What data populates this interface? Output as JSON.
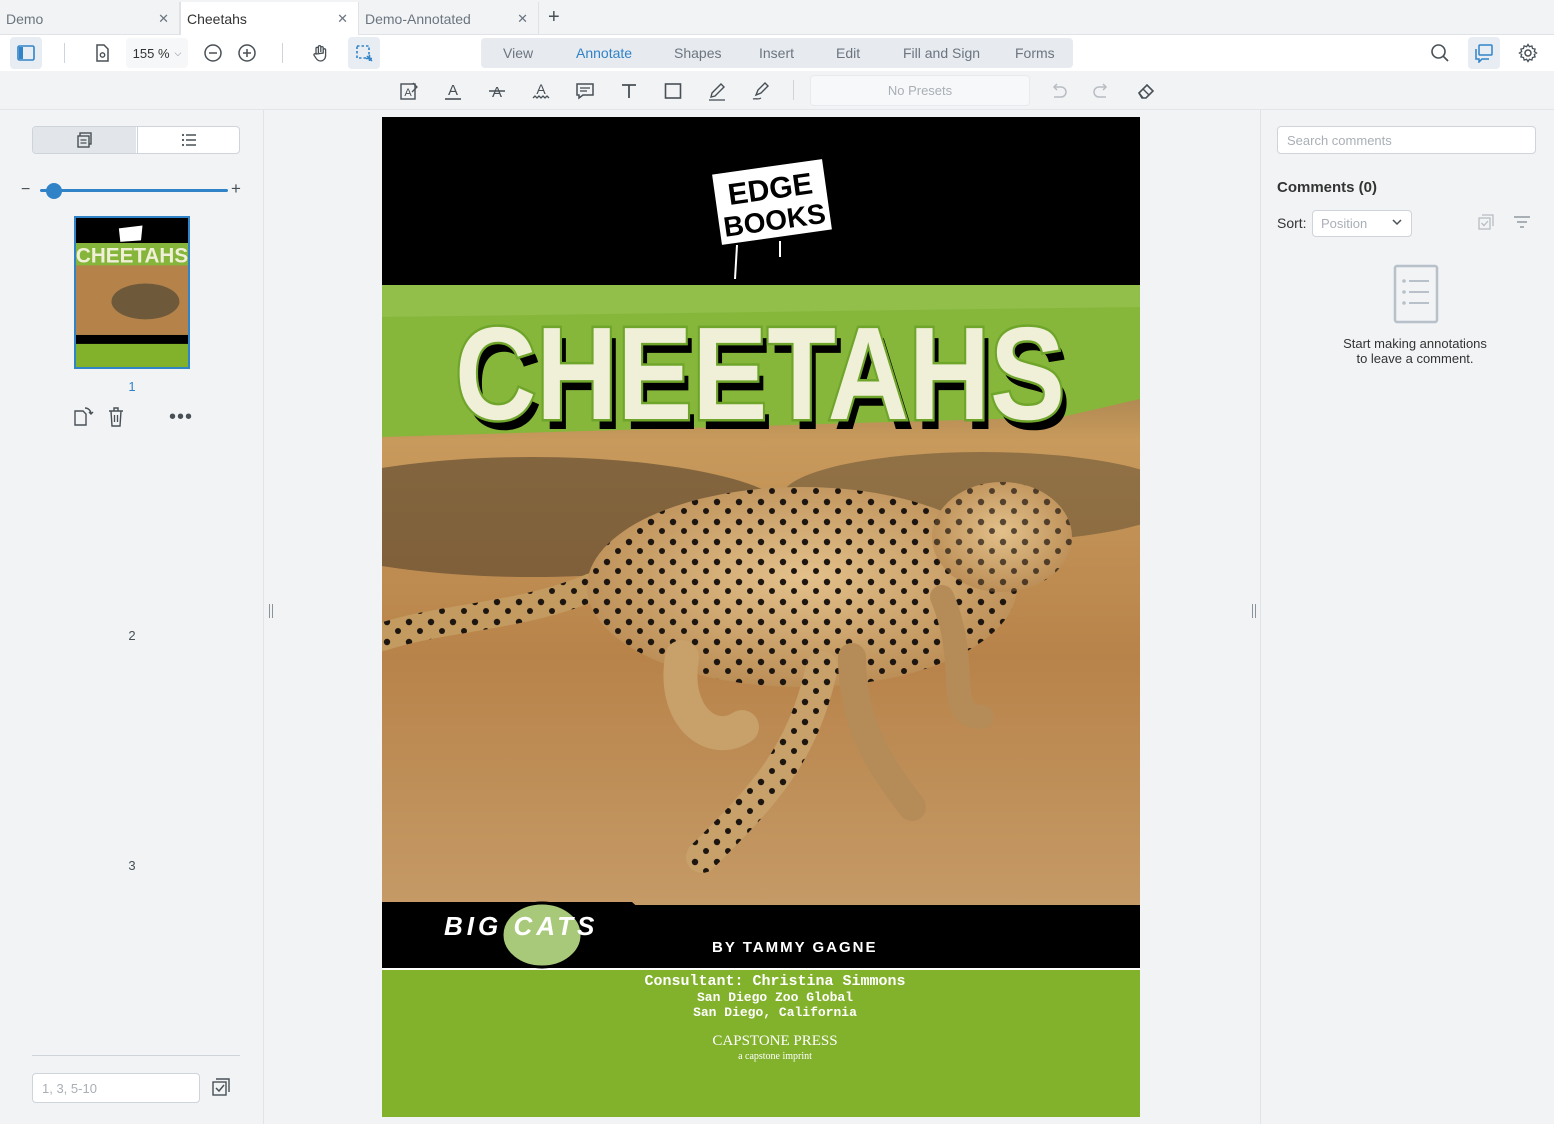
{
  "tabs": [
    {
      "label": "Demo",
      "active": false
    },
    {
      "label": "Cheetahs",
      "active": true
    },
    {
      "label": "Demo-Annotated",
      "active": false
    }
  ],
  "header": {
    "zoom": "155 %",
    "ribbons": [
      "View",
      "Annotate",
      "Shapes",
      "Insert",
      "Edit",
      "Fill and Sign",
      "Forms"
    ],
    "active_ribbon": "Annotate"
  },
  "toolbar": {
    "presets": "No Presets"
  },
  "left_panel": {
    "pages": [
      "1",
      "2",
      "3"
    ],
    "page_input_placeholder": "1, 3, 5-10"
  },
  "document": {
    "publisher_logo": "EDGE BOOKS",
    "title": "CHEETAHS",
    "series": "BIG CATS",
    "author": "BY TAMMY GAGNE",
    "consultant": "Consultant: Christina Simmons",
    "org": "San Diego Zoo Global",
    "location": "San Diego, California",
    "press": "CAPSTONE PRESS",
    "imprint": "a capstone imprint"
  },
  "right_panel": {
    "search_placeholder": "Search comments",
    "comments_title": "Comments (0)",
    "sort_label": "Sort:",
    "sort_value": "Position",
    "empty_line1": "Start making annotations",
    "empty_line2": "to leave a comment."
  },
  "colors": {
    "accent": "#3183c8",
    "cover_green": "#82b12b",
    "title_cream": "#f0efd8"
  }
}
